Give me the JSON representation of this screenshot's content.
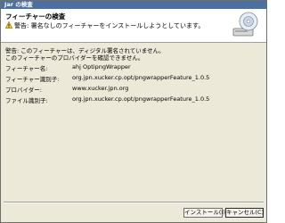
{
  "window": {
    "title": "Jar の検査"
  },
  "header": {
    "title": "フィーチャーの検査",
    "message": "警告: 署名なしのフィーチャーをインストールしようとしています。"
  },
  "body": {
    "warning_line1": "警告: このフィーチャーは、ディジタル署名されていません。",
    "warning_line2": "このフィーチャーのプロバイダーを確認できません。",
    "fields": [
      {
        "label": "フィーチャー名:",
        "value": "ahj OptipngWrapper"
      },
      {
        "label": "フィーチャー識別子:",
        "value": "org.jpn.xucker.cp.opt/pngwrapperFeature_1.0.5"
      },
      {
        "label": "プロバイダー:",
        "value": "www.xucker.jpn.org"
      },
      {
        "label": "ファイル識別子:",
        "value": "org.jpn.xucker.cp.opt/pngwrapperFeature_1.0.5"
      }
    ]
  },
  "buttons": {
    "install": "インストール(I)",
    "cancel": "キャンセル(C)"
  },
  "icons": {
    "warning": "warning-icon",
    "disk": "install-disk-icon"
  }
}
